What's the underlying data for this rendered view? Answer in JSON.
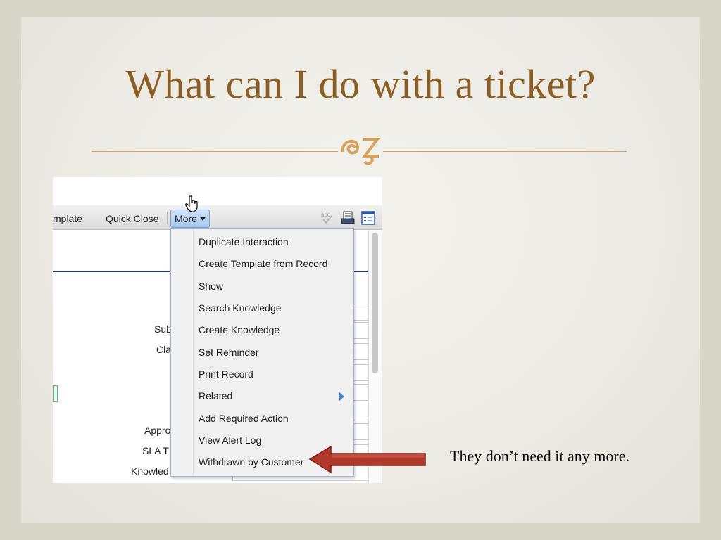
{
  "slide": {
    "title": "What can I do with a ticket?",
    "note": "They don’t need it any more."
  },
  "toolbar": {
    "template_label": "mplate",
    "quick_close_label": "Quick Close",
    "more_label": "More"
  },
  "form_labels": [
    "Sub",
    "Cla",
    "Appro",
    "SLA T",
    "Knowled"
  ],
  "menu": {
    "items": [
      {
        "label": "Duplicate Interaction"
      },
      {
        "label": "Create Template from Record"
      },
      {
        "label": "Show"
      },
      {
        "label": "Search Knowledge"
      },
      {
        "label": "Create Knowledge"
      },
      {
        "label": "Set Reminder"
      },
      {
        "label": "Print Record"
      },
      {
        "label": "Related"
      },
      {
        "label": "Add Required Action"
      },
      {
        "label": "View Alert Log"
      },
      {
        "label": "Withdrawn by Customer"
      }
    ]
  },
  "icons": [
    "spellcheck-icon",
    "print-icon",
    "form-view-icon",
    "hand-cursor-icon",
    "ornament-icon",
    "pointer-arrow-icon"
  ],
  "colors": {
    "title": "#8b5e24",
    "rule": "#d9a25a",
    "arrow": "#b0392b",
    "menu_border": "#9fb6d6"
  }
}
